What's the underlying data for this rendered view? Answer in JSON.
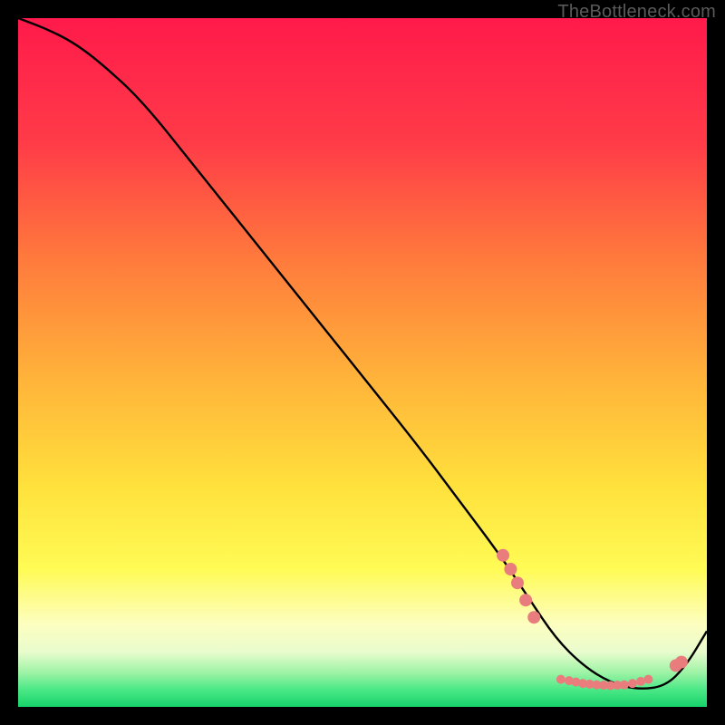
{
  "watermark": "TheBottleneck.com",
  "chart_data": {
    "type": "line",
    "title": "",
    "xlabel": "",
    "ylabel": "",
    "xlim": [
      0,
      100
    ],
    "ylim": [
      0,
      100
    ],
    "grid": false,
    "legend": false,
    "gradient_stops": [
      {
        "offset": 0.0,
        "color": "#ff1a4b"
      },
      {
        "offset": 0.18,
        "color": "#ff3b48"
      },
      {
        "offset": 0.35,
        "color": "#ff7a3c"
      },
      {
        "offset": 0.52,
        "color": "#ffb23a"
      },
      {
        "offset": 0.68,
        "color": "#ffe13c"
      },
      {
        "offset": 0.8,
        "color": "#fffb55"
      },
      {
        "offset": 0.88,
        "color": "#fdfec0"
      },
      {
        "offset": 0.92,
        "color": "#e9fccd"
      },
      {
        "offset": 0.95,
        "color": "#9ef3a6"
      },
      {
        "offset": 0.975,
        "color": "#4be886"
      },
      {
        "offset": 1.0,
        "color": "#17d36a"
      }
    ],
    "series": [
      {
        "name": "bottleneck-curve",
        "color": "#000000",
        "x": [
          0,
          4,
          8,
          12,
          18,
          26,
          34,
          42,
          50,
          58,
          64,
          70,
          74,
          78,
          82,
          86,
          90,
          94,
          97,
          100
        ],
        "y": [
          100,
          98.5,
          96.5,
          93.5,
          88,
          78,
          68,
          58,
          48,
          38,
          30,
          22,
          16,
          10,
          6,
          3.5,
          2.5,
          3,
          6,
          11
        ]
      }
    ],
    "highlight_points": {
      "color": "#e97d7d",
      "radius_large": 7,
      "radius_small": 5,
      "coords": [
        {
          "x": 70.4,
          "y": 22
        },
        {
          "x": 71.5,
          "y": 20
        },
        {
          "x": 72.5,
          "y": 18
        },
        {
          "x": 73.7,
          "y": 15.5
        },
        {
          "x": 74.9,
          "y": 13
        },
        {
          "x": 78.8,
          "y": 4
        },
        {
          "x": 80.0,
          "y": 3.8
        },
        {
          "x": 81.0,
          "y": 3.6
        },
        {
          "x": 82.0,
          "y": 3.4
        },
        {
          "x": 83.0,
          "y": 3.3
        },
        {
          "x": 84.0,
          "y": 3.2
        },
        {
          "x": 85.0,
          "y": 3.15
        },
        {
          "x": 86.0,
          "y": 3.1
        },
        {
          "x": 87.0,
          "y": 3.15
        },
        {
          "x": 88.0,
          "y": 3.2
        },
        {
          "x": 89.2,
          "y": 3.4
        },
        {
          "x": 90.4,
          "y": 3.7
        },
        {
          "x": 91.5,
          "y": 4.0
        },
        {
          "x": 95.5,
          "y": 6
        },
        {
          "x": 96.3,
          "y": 6.5
        }
      ]
    }
  }
}
